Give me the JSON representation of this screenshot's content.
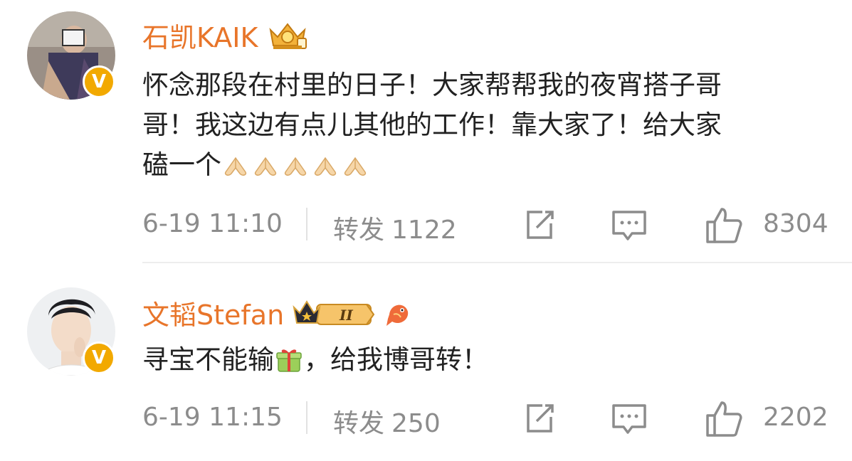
{
  "comments": [
    {
      "username": "石凯KAIK",
      "badge": "gold-crown-vip-icon",
      "verified": "V",
      "text_lines": [
        "怀念那段在村里的日子！大家帮帮我的夜宵搭子哥",
        "哥！我这边有点儿其他的工作！靠大家了！给大家",
        "磕一个"
      ],
      "emoji_trailing": "folded-hands-emoji x5",
      "time": "6-19 11:10",
      "repost_label": "转发",
      "repost_count": "1122",
      "like_count": "8304"
    },
    {
      "username": "文韬Stefan",
      "badge": "crown-level-II-icon",
      "badge_level": "II",
      "extra_badge": "fish-icon",
      "verified": "V",
      "text_before": "寻宝不能输",
      "text_after": "，给我博哥转！",
      "emoji_inline": "gift-emoji",
      "time": "6-19 11:15",
      "repost_label": "转发",
      "repost_count": "250",
      "like_count": "2202"
    }
  ],
  "colors": {
    "username": "#e8752a",
    "meta": "#8c8c8c",
    "verified_badge": "#f2a900"
  }
}
